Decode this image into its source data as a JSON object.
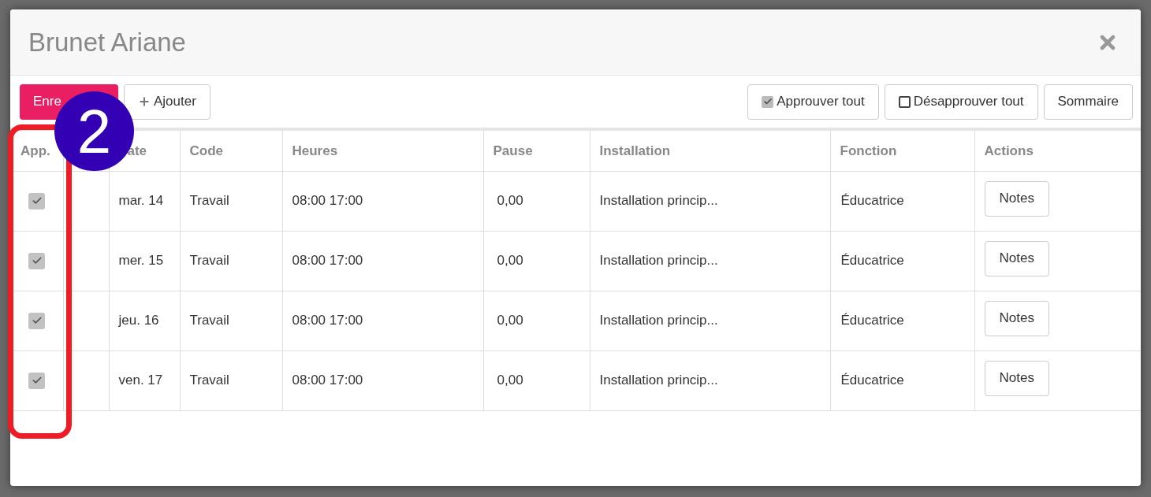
{
  "modal": {
    "title": "Brunet Ariane"
  },
  "toolbar": {
    "left": [
      {
        "label": "Enre",
        "kind": "primary"
      },
      {
        "label": "Ajouter",
        "kind": "add"
      }
    ],
    "right": [
      {
        "label": "Approuver tout",
        "kind": "approve"
      },
      {
        "label": "Désapprouver tout",
        "kind": "disapprove"
      },
      {
        "label": "Sommaire",
        "kind": "plain"
      }
    ]
  },
  "table": {
    "columns": [
      "App.",
      "ate",
      "Code",
      "Heures",
      "Pause",
      "Installation",
      "Fonction",
      "Actions"
    ],
    "rows": [
      {
        "approved": true,
        "date": "mar. 14",
        "code": "Travail",
        "hours": "08:00 17:00",
        "pause": "0,00",
        "installation": "Installation princip...",
        "function": "Éducatrice",
        "action": "Notes"
      },
      {
        "approved": true,
        "date": "mer. 15",
        "code": "Travail",
        "hours": "08:00 17:00",
        "pause": "0,00",
        "installation": "Installation princip...",
        "function": "Éducatrice",
        "action": "Notes"
      },
      {
        "approved": true,
        "date": "jeu. 16",
        "code": "Travail",
        "hours": "08:00 17:00",
        "pause": "0,00",
        "installation": "Installation princip...",
        "function": "Éducatrice",
        "action": "Notes"
      },
      {
        "approved": true,
        "date": "ven. 17",
        "code": "Travail",
        "hours": "08:00 17:00",
        "pause": "0,00",
        "installation": "Installation princip...",
        "function": "Éducatrice",
        "action": "Notes"
      }
    ]
  },
  "annotation": {
    "number": "2"
  }
}
